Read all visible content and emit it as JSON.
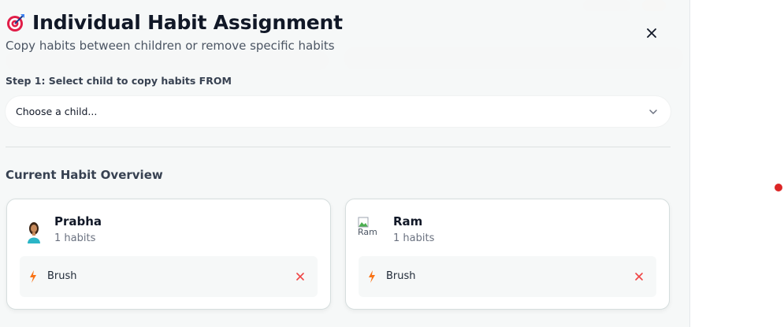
{
  "modal": {
    "title": "Individual Habit Assignment",
    "subtitle": "Copy habits between children or remove specific habits",
    "title_icon": "target-icon",
    "close_icon": "close-icon"
  },
  "step1": {
    "label": "Step 1: Select child to copy habits FROM",
    "select_value": "Choose a child..."
  },
  "overview": {
    "title": "Current Habit Overview",
    "children": [
      {
        "name": "Prabha",
        "count": "1 habits",
        "avatar": "photo",
        "habits": [
          {
            "name": "Brush",
            "icon": "bolt-icon"
          }
        ]
      },
      {
        "name": "Ram",
        "count": "1 habits",
        "avatar_alt": "Ram",
        "habits": [
          {
            "name": "Brush",
            "icon": "bolt-icon"
          }
        ]
      }
    ]
  },
  "colors": {
    "accent_orange": "#f97316",
    "remove_red": "#ef4444",
    "notification_dot": "#dc2626"
  }
}
